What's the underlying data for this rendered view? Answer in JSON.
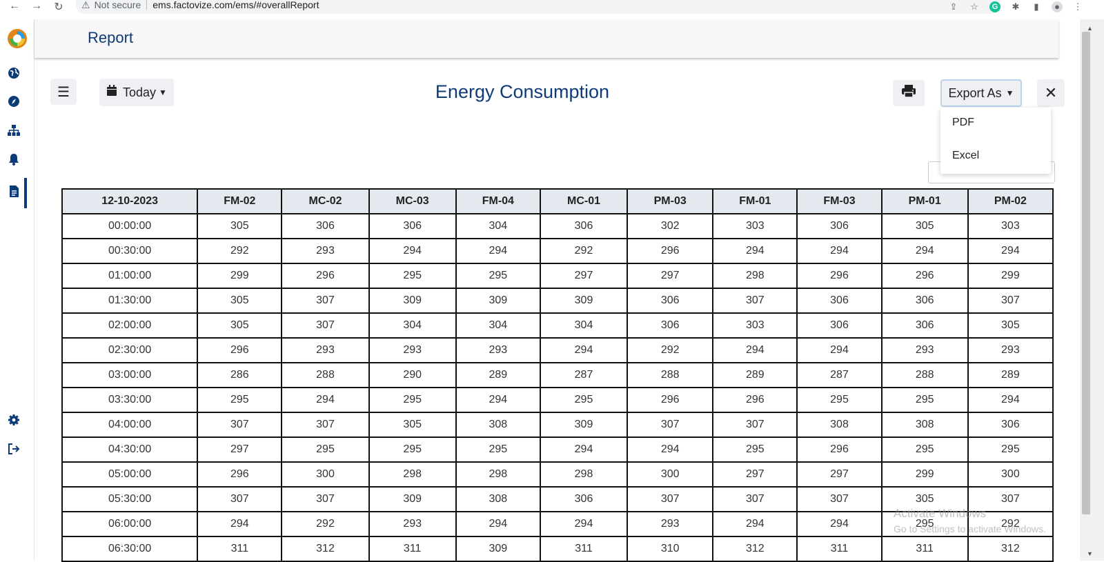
{
  "browser": {
    "back": "←",
    "forward": "→",
    "reload": "↻",
    "security": "Not secure",
    "url": "ems.factovize.com/ems/#overallReport"
  },
  "header": {
    "title": "Report"
  },
  "toolbar": {
    "date_filter": "Today",
    "export_label": "Export As"
  },
  "report": {
    "title": "Energy Consumption"
  },
  "export_menu": {
    "items": [
      "PDF",
      "Excel"
    ]
  },
  "table": {
    "columns": [
      "12-10-2023",
      "FM-02",
      "MC-02",
      "MC-03",
      "FM-04",
      "MC-01",
      "PM-03",
      "FM-01",
      "FM-03",
      "PM-01",
      "PM-02"
    ],
    "rows": [
      [
        "00:00:00",
        "305",
        "306",
        "306",
        "304",
        "306",
        "302",
        "303",
        "306",
        "305",
        "303"
      ],
      [
        "00:30:00",
        "292",
        "293",
        "294",
        "294",
        "292",
        "296",
        "294",
        "294",
        "294",
        "294"
      ],
      [
        "01:00:00",
        "299",
        "296",
        "295",
        "295",
        "297",
        "297",
        "298",
        "296",
        "296",
        "299"
      ],
      [
        "01:30:00",
        "305",
        "307",
        "309",
        "309",
        "309",
        "306",
        "307",
        "306",
        "306",
        "307"
      ],
      [
        "02:00:00",
        "305",
        "307",
        "304",
        "304",
        "304",
        "306",
        "303",
        "306",
        "306",
        "305"
      ],
      [
        "02:30:00",
        "296",
        "293",
        "293",
        "293",
        "294",
        "292",
        "294",
        "294",
        "293",
        "293"
      ],
      [
        "03:00:00",
        "286",
        "288",
        "290",
        "289",
        "287",
        "288",
        "289",
        "287",
        "288",
        "289"
      ],
      [
        "03:30:00",
        "295",
        "294",
        "295",
        "294",
        "295",
        "296",
        "296",
        "295",
        "295",
        "294"
      ],
      [
        "04:00:00",
        "307",
        "307",
        "305",
        "308",
        "309",
        "307",
        "307",
        "308",
        "308",
        "306"
      ],
      [
        "04:30:00",
        "297",
        "295",
        "295",
        "295",
        "294",
        "294",
        "295",
        "296",
        "295",
        "295"
      ],
      [
        "05:00:00",
        "296",
        "300",
        "298",
        "298",
        "298",
        "300",
        "297",
        "297",
        "299",
        "300"
      ],
      [
        "05:30:00",
        "307",
        "307",
        "309",
        "308",
        "306",
        "307",
        "307",
        "307",
        "305",
        "307"
      ],
      [
        "06:00:00",
        "294",
        "292",
        "293",
        "294",
        "294",
        "293",
        "294",
        "294",
        "295",
        "292"
      ],
      [
        "06:30:00",
        "311",
        "312",
        "311",
        "309",
        "311",
        "310",
        "312",
        "311",
        "311",
        "312"
      ]
    ]
  },
  "watermark": {
    "line1": "Activate Windows",
    "line2": "Go to Settings to activate Windows."
  }
}
